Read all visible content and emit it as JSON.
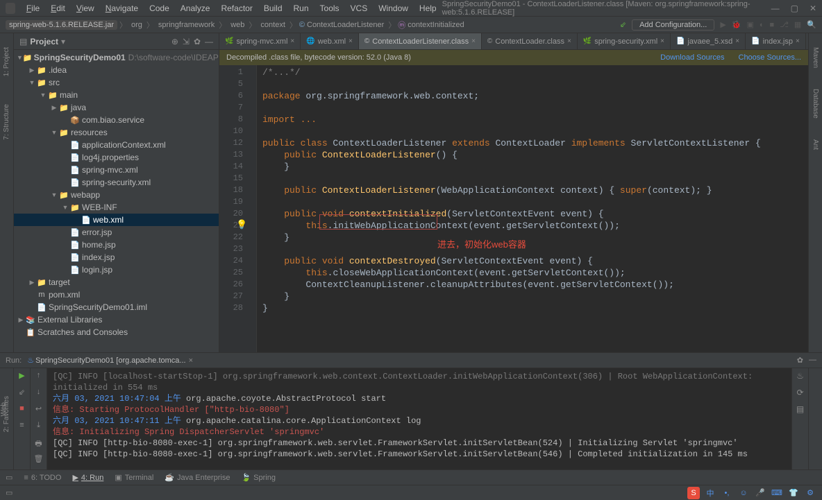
{
  "window": {
    "title": "SpringSecurityDemo01 - ContextLoaderListener.class [Maven: org.springframework:spring-web:5.1.6.RELEASE]"
  },
  "menu": {
    "file": "File",
    "edit": "Edit",
    "view": "View",
    "navigate": "Navigate",
    "code": "Code",
    "analyze": "Analyze",
    "refactor": "Refactor",
    "build": "Build",
    "run": "Run",
    "tools": "Tools",
    "vcs": "VCS",
    "window": "Window",
    "help": "Help"
  },
  "breadcrumb": {
    "jar": "spring-web-5.1.6.RELEASE.jar",
    "parts": [
      "org",
      "springframework",
      "web",
      "context",
      "ContextLoaderListener",
      "contextInitialized"
    ]
  },
  "toolbar": {
    "add_config": "Add Configuration..."
  },
  "project_panel": {
    "title": "Project"
  },
  "tree": {
    "root": "SpringSecurityDemo01",
    "root_path": "D:\\software-code\\IDEAProject",
    "items": [
      {
        "indent": 1,
        "arrow": "▶",
        "icon": "📁",
        "cls": "folder",
        "label": ".idea"
      },
      {
        "indent": 1,
        "arrow": "▼",
        "icon": "📁",
        "cls": "folder-blue",
        "label": "src"
      },
      {
        "indent": 2,
        "arrow": "▼",
        "icon": "📁",
        "cls": "folder-blue",
        "label": "main"
      },
      {
        "indent": 3,
        "arrow": "▶",
        "icon": "📁",
        "cls": "folder-blue",
        "label": "java"
      },
      {
        "indent": 4,
        "arrow": "",
        "icon": "📦",
        "cls": "",
        "label": "com.biao.service"
      },
      {
        "indent": 3,
        "arrow": "▼",
        "icon": "📁",
        "cls": "folder-blue",
        "label": "resources"
      },
      {
        "indent": 4,
        "arrow": "",
        "icon": "📄",
        "cls": "file-xml",
        "label": "applicationContext.xml"
      },
      {
        "indent": 4,
        "arrow": "",
        "icon": "📄",
        "cls": "",
        "label": "log4j.properties"
      },
      {
        "indent": 4,
        "arrow": "",
        "icon": "📄",
        "cls": "file-xml",
        "label": "spring-mvc.xml"
      },
      {
        "indent": 4,
        "arrow": "",
        "icon": "📄",
        "cls": "file-xml",
        "label": "spring-security.xml"
      },
      {
        "indent": 3,
        "arrow": "▼",
        "icon": "📁",
        "cls": "folder-blue",
        "label": "webapp"
      },
      {
        "indent": 4,
        "arrow": "▼",
        "icon": "📁",
        "cls": "folder-blue",
        "label": "WEB-INF"
      },
      {
        "indent": 5,
        "arrow": "",
        "icon": "📄",
        "cls": "file-xml",
        "label": "web.xml",
        "selected": true
      },
      {
        "indent": 4,
        "arrow": "",
        "icon": "📄",
        "cls": "file-jsp",
        "label": "error.jsp"
      },
      {
        "indent": 4,
        "arrow": "",
        "icon": "📄",
        "cls": "file-jsp",
        "label": "home.jsp"
      },
      {
        "indent": 4,
        "arrow": "",
        "icon": "📄",
        "cls": "file-jsp",
        "label": "index.jsp"
      },
      {
        "indent": 4,
        "arrow": "",
        "icon": "📄",
        "cls": "file-jsp",
        "label": "login.jsp"
      },
      {
        "indent": 1,
        "arrow": "▶",
        "icon": "📁",
        "cls": "folder",
        "label": "target"
      },
      {
        "indent": 1,
        "arrow": "",
        "icon": "m",
        "cls": "",
        "label": "pom.xml"
      },
      {
        "indent": 1,
        "arrow": "",
        "icon": "📄",
        "cls": "",
        "label": "SpringSecurityDemo01.iml"
      },
      {
        "indent": 0,
        "arrow": "▶",
        "icon": "📚",
        "cls": "",
        "label": "External Libraries"
      },
      {
        "indent": 0,
        "arrow": "",
        "icon": "📋",
        "cls": "",
        "label": "Scratches and Consoles"
      }
    ]
  },
  "tabs": [
    {
      "icon": "🌿",
      "label": "spring-mvc.xml",
      "active": false
    },
    {
      "icon": "🌐",
      "label": "web.xml",
      "active": false
    },
    {
      "icon": "©",
      "label": "ContextLoaderListener.class",
      "active": true
    },
    {
      "icon": "©",
      "label": "ContextLoader.class",
      "active": false
    },
    {
      "icon": "🌿",
      "label": "spring-security.xml",
      "active": false
    },
    {
      "icon": "📄",
      "label": "javaee_5.xsd",
      "active": false
    },
    {
      "icon": "📄",
      "label": "index.jsp",
      "active": false
    }
  ],
  "decompile": {
    "msg": "Decompiled .class file, bytecode version: 52.0 (Java 8)",
    "download": "Download Sources",
    "choose": "Choose Sources..."
  },
  "code_lines": [
    "1",
    "5",
    "6",
    "7",
    "8",
    "10",
    "12",
    "13",
    "14",
    "15",
    "18",
    "19",
    "20",
    "21",
    "22",
    "23",
    "24",
    "25",
    "26",
    "27",
    "28"
  ],
  "annotation": "进去，初始化web容器",
  "run": {
    "header_title": "Run:",
    "config": "SpringSecurityDemo01 [org.apache.tomca...",
    "lines": [
      {
        "gray": "[QC] INFO [localhost-startStop-1] org.springframework.web.context.ContextLoader.initWebApplicationContext(306) | Root WebApplicationContext: initialized in 554 ms"
      },
      {
        "ts": "六月 03, 2021 10:47:04 上午",
        "rest": " org.apache.coyote.AbstractProtocol start"
      },
      {
        "info": "信息: Starting ProtocolHandler [\"http-bio-8080\"]"
      },
      {
        "ts": "六月 03, 2021 10:47:11 上午",
        "rest": " org.apache.catalina.core.ApplicationContext log"
      },
      {
        "info": "信息: Initializing Spring DispatcherServlet 'springmvc'"
      },
      {
        "plain": "[QC] INFO [http-bio-8080-exec-1] org.springframework.web.servlet.FrameworkServlet.initServletBean(524) | Initializing Servlet 'springmvc'"
      },
      {
        "plain": "[QC] INFO [http-bio-8080-exec-1] org.springframework.web.servlet.FrameworkServlet.initServletBean(546) | Completed initialization in 145 ms"
      }
    ]
  },
  "bottom_tabs": {
    "todo": "6: TODO",
    "run": "4: Run",
    "terminal": "Terminal",
    "javaee": "Java Enterprise",
    "spring": "Spring"
  },
  "side_left": {
    "project": "1: Project",
    "structure": "7: Structure",
    "favorites": "2: Favorites",
    "web": "Web"
  },
  "side_right": {
    "maven": "Maven",
    "database": "Database",
    "ant": "Ant"
  }
}
